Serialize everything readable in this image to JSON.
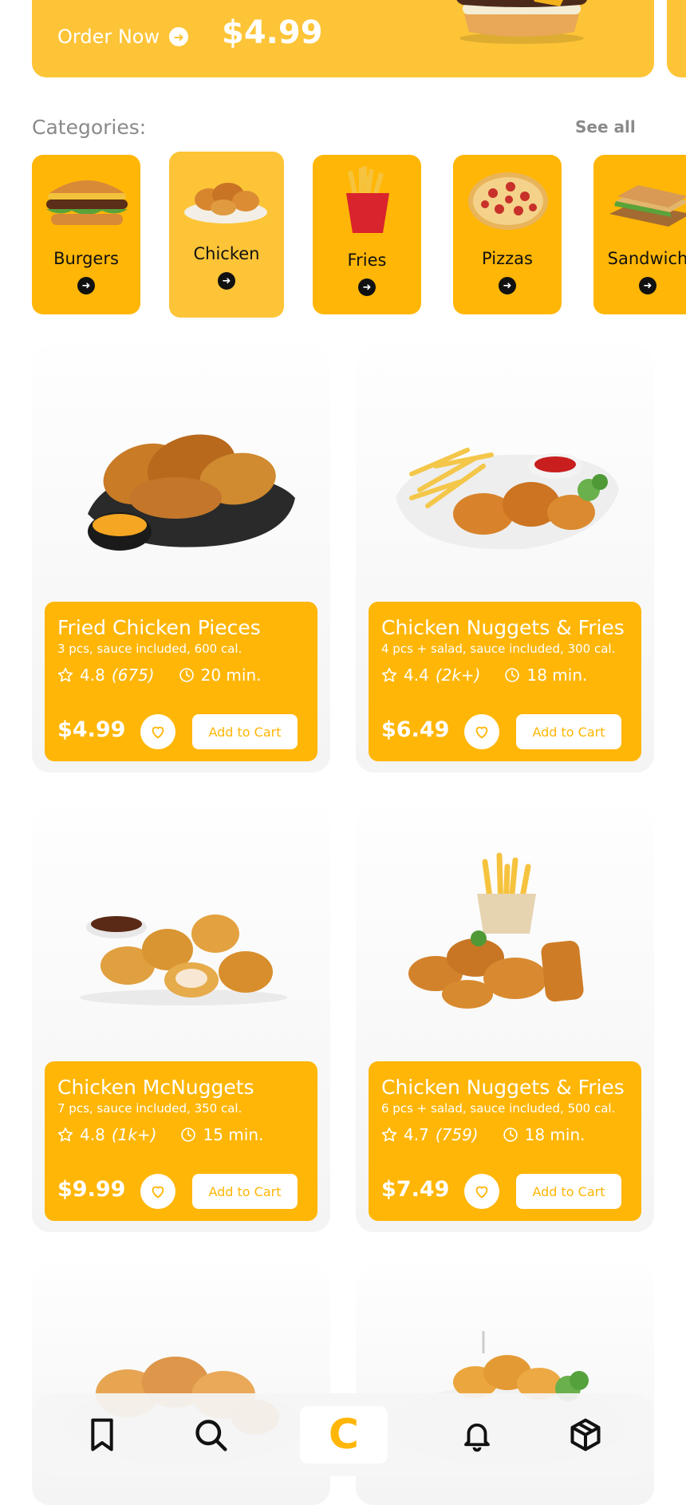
{
  "promo": {
    "order_label": "Order Now",
    "price": "$4.99"
  },
  "categories": {
    "title": "Categories:",
    "see_all": "See all",
    "items": [
      {
        "label": "Burgers"
      },
      {
        "label": "Chicken",
        "active": true
      },
      {
        "label": "Fries"
      },
      {
        "label": "Pizzas"
      },
      {
        "label": "Sandwich"
      }
    ]
  },
  "products": [
    {
      "name": "Fried Chicken Pieces",
      "desc": "3 pcs, sauce included, 600 cal.",
      "rating": "4.8",
      "count": "(675)",
      "time": "20 min.",
      "price": "$4.99",
      "cart": "Add to Cart"
    },
    {
      "name": "Chicken Nuggets & Fries",
      "desc": "4 pcs + salad, sauce included, 300 cal.",
      "rating": "4.4",
      "count": "(2k+)",
      "time": "18 min.",
      "price": "$6.49",
      "cart": "Add to Cart"
    },
    {
      "name": "Chicken McNuggets",
      "desc": "7 pcs, sauce included, 350 cal.",
      "rating": "4.8",
      "count": "(1k+)",
      "time": "15 min.",
      "price": "$9.99",
      "cart": "Add to Cart"
    },
    {
      "name": "Chicken Nuggets & Fries",
      "desc": "6 pcs + salad, sauce included, 500 cal.",
      "rating": "4.7",
      "count": "(759)",
      "time": "18 min.",
      "price": "$7.49",
      "cart": "Add to Cart"
    }
  ],
  "bottom_nav": {
    "home_logo": "C",
    "items": [
      "bookmark-icon",
      "search-icon",
      "home-logo",
      "bell-icon",
      "package-icon"
    ]
  },
  "colors": {
    "primary": "#ffb606",
    "light_yellow": "#fdc437",
    "text_dark": "#111111",
    "muted": "#8a8a8a"
  }
}
